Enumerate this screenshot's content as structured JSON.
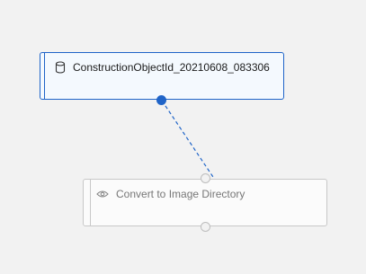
{
  "nodes": {
    "source": {
      "title": "ConstructionObjectId_20210608_083306",
      "icon": "dataset-icon",
      "state": "selected",
      "border_color": "#1f64c8"
    },
    "target": {
      "title": "Convert to Image Directory",
      "icon": "eye-icon",
      "state": "inactive",
      "border_color": "#c8c8c8"
    }
  },
  "edge": {
    "style": "dashed",
    "color": "#1f64c8"
  },
  "colors": {
    "canvas_background": "#f2f2f2",
    "accent": "#1f64c8"
  }
}
